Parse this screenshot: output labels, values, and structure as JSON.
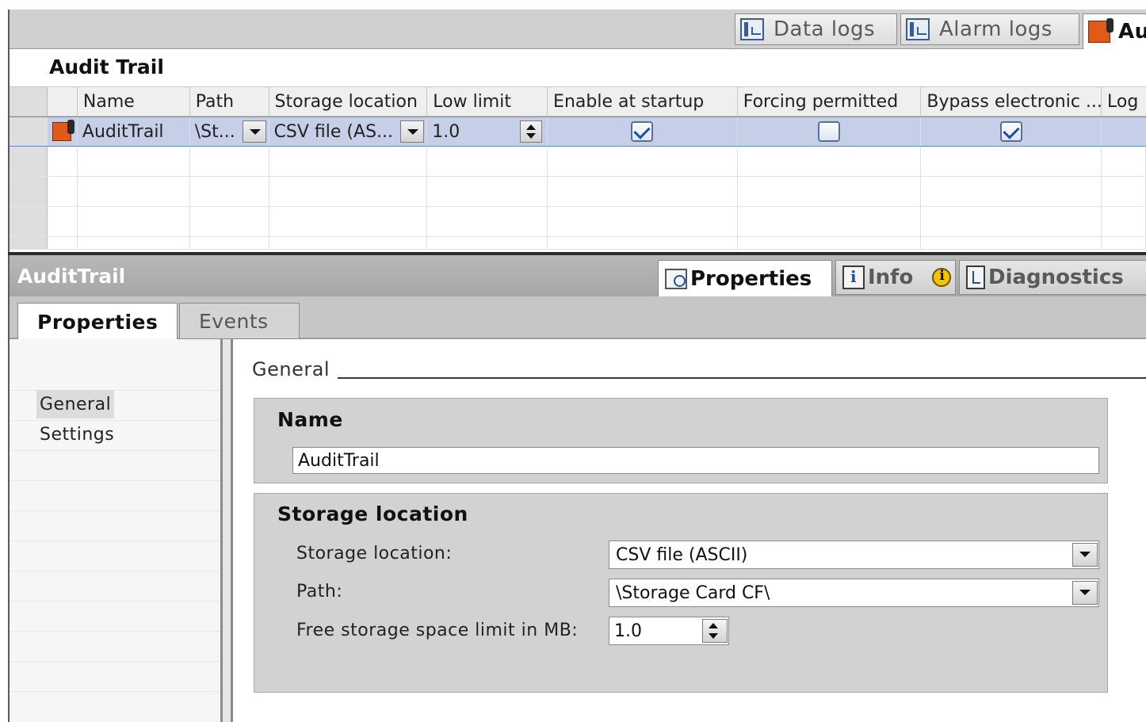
{
  "editor_tabs": [
    {
      "label": "Data logs",
      "icon": "data-log-icon",
      "active": false
    },
    {
      "label": "Alarm logs",
      "icon": "alarm-log-icon",
      "active": false
    },
    {
      "label": "Au",
      "icon": "audit-trail-icon",
      "active": true
    }
  ],
  "editor_title": "Audit Trail",
  "table": {
    "columns": [
      "Name",
      "Path",
      "Storage location",
      "Low limit",
      "Enable at startup",
      "Forcing permitted",
      "Bypass electronic ...",
      "Log"
    ],
    "rows": [
      {
        "name": "AuditTrail",
        "path": "\\St...",
        "storage_location": "CSV file (AS...",
        "low_limit": "1.0",
        "enable_at_startup": true,
        "forcing_permitted": false,
        "bypass_electronic": true
      }
    ]
  },
  "inspector": {
    "title": "AuditTrail",
    "tabs": [
      {
        "label": "Properties",
        "icon": "properties-icon",
        "active": true
      },
      {
        "label": "Info",
        "icon": "info-icon",
        "badge": "info-badge-icon",
        "active": false
      },
      {
        "label": "Diagnostics",
        "icon": "diagnostics-icon",
        "active": false
      }
    ],
    "subtabs": [
      {
        "label": "Properties",
        "active": true
      },
      {
        "label": "Events",
        "active": false
      }
    ],
    "nav_items": [
      {
        "label": "General",
        "selected": true
      },
      {
        "label": "Settings",
        "selected": false
      }
    ],
    "section_heading": "General",
    "name_group": {
      "title": "Name",
      "value": "AuditTrail"
    },
    "storage_group": {
      "title": "Storage location",
      "storage_location_label": "Storage location:",
      "storage_location_value": "CSV file (ASCII)",
      "path_label": "Path:",
      "path_value": "\\Storage Card CF\\",
      "free_space_label": "Free storage space limit in MB:",
      "free_space_value": "1.0"
    }
  },
  "colors": {
    "selected_row": "#c5d0e8",
    "checkbox_check": "#1a4fa8",
    "audit_icon": "#e25a1a",
    "info_badge": "#f2c500"
  }
}
